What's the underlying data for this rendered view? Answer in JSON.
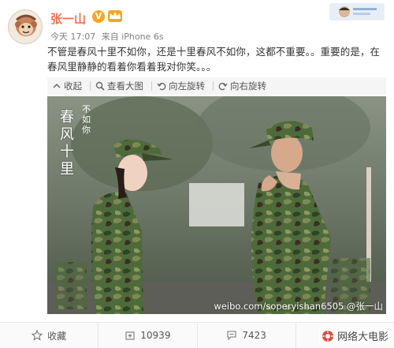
{
  "user": {
    "name": "张一山",
    "verified_mark": "V",
    "vip_mark": "VIP"
  },
  "post": {
    "time": "今天 17:07",
    "source": "来自 iPhone 6s",
    "text": "不管是春风十里不如你，还是十里春风不如你，这都不重要。。重要的是，在春风里静静的看着你看着我对你笑。。。"
  },
  "image_toolbar": {
    "collapse": "收起",
    "view_large": "查看大图",
    "rotate_left": "向左旋转",
    "rotate_right": "向右旋转"
  },
  "photo": {
    "poster_title": "春风十里",
    "poster_sub": "不如你",
    "watermark": "weibo.com/soperyishan6505 @张一山"
  },
  "footer": {
    "favorite": "收藏",
    "repost_count": "10939",
    "comment_count": "7423",
    "like_count": ""
  },
  "corner_logo": {
    "text": "网络大电影"
  },
  "colors": {
    "name": "#eb7350",
    "badge": "#f6a623"
  }
}
